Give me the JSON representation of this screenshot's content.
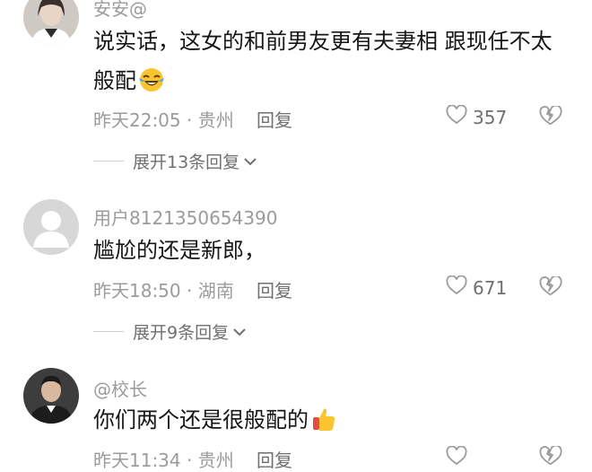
{
  "comments": [
    {
      "username": "安安@",
      "text": "说实话，这女的和前男友更有夫妻相 跟现任不太般配",
      "emoji": "laughing-crying-emoji",
      "time": "昨天22:05",
      "location": "贵州",
      "reply_label": "回复",
      "likes": "357",
      "expand_label": "展开13条回复"
    },
    {
      "username": "用户8121350654390",
      "text": "尴尬的还是新郎，",
      "time": "昨天18:50",
      "location": "湖南",
      "reply_label": "回复",
      "likes": "671",
      "expand_label": "展开9条回复"
    },
    {
      "username": "@校长",
      "text": "你们两个还是很般配的",
      "emoji": "thumbs-up-emoji",
      "time": "昨天11:34",
      "location": "贵州",
      "reply_label": "回复"
    }
  ],
  "colors": {
    "meta_gray": "#9b9b9b",
    "action_gray": "#6f6f6f",
    "text": "#161616"
  }
}
